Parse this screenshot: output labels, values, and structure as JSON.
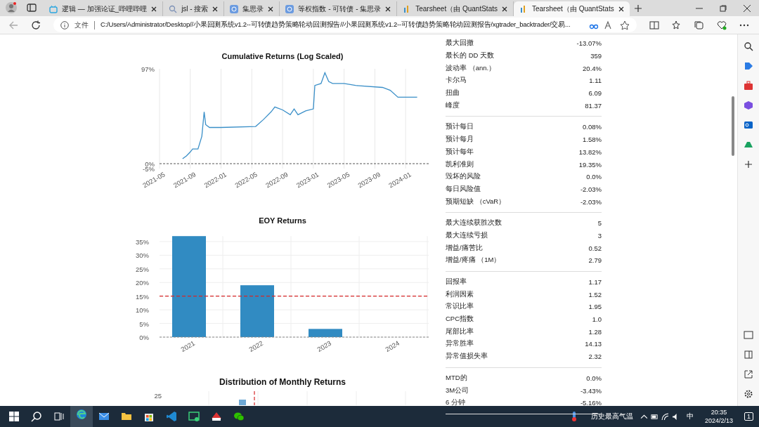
{
  "tabs": [
    {
      "label": "逻辑 — 加强论证_哔哩哔哩",
      "selected": false
    },
    {
      "label": "jsl - 搜索",
      "selected": false
    },
    {
      "label": "集思录",
      "selected": false
    },
    {
      "label": "等权指数 - 可转债 - 集思录",
      "selected": false
    },
    {
      "label": "Tearsheet（由 QuantStats",
      "selected": false
    },
    {
      "label": "Tearsheet（由 QuantStats",
      "selected": true
    }
  ],
  "address_bar": {
    "scheme_label": "文件",
    "url": "C:/Users/Administrator/Desktop//小果回测系统v1.2--可转债趋势策略轮动回测报告//小果回测系统v1.2--可转债趋势策略轮动回测报告/xgtrader_backtrader/交易..."
  },
  "cumulative_returns": {
    "chart_data": {
      "type": "line",
      "title": "Cumulative Returns (Log Scaled)",
      "x": [
        "2021-08-01",
        "2021-08-16",
        "2021-09-01",
        "2021-09-10",
        "2021-09-20",
        "2021-10-01",
        "2021-10-16",
        "2021-10-25",
        "2021-11-01",
        "2021-11-16",
        "2022-01-01",
        "2022-05-16",
        "2022-06-16",
        "2022-07-16",
        "2022-08-01",
        "2022-09-01",
        "2022-10-01",
        "2022-10-16",
        "2022-11-01",
        "2022-12-01",
        "2023-01-01",
        "2023-01-07",
        "2023-02-01",
        "2023-02-16",
        "2023-03-01",
        "2023-03-16",
        "2023-05-01",
        "2023-06-16",
        "2023-10-01",
        "2023-11-01",
        "2023-12-01",
        "2024-02-16"
      ],
      "series": [
        {
          "color": "#3a8fc8",
          "values": [
            5,
            8,
            12,
            15,
            15,
            15,
            28,
            53,
            40,
            37,
            37,
            38,
            45,
            53,
            58,
            55,
            50,
            56,
            50,
            54,
            56,
            80,
            82,
            93,
            84,
            82,
            82,
            80,
            78,
            75,
            68,
            68
          ]
        }
      ],
      "xlim": [
        "2021-05-01",
        "2024-04-01"
      ],
      "ylim": [
        -5,
        97
      ],
      "grid": true,
      "ref_lines": [
        {
          "axis": "y",
          "value": 0,
          "color": "#555555"
        }
      ],
      "xticks": [
        "2021-05",
        "2021-09",
        "2022-01",
        "2022-05",
        "2022-09",
        "2023-01",
        "2023-05",
        "2023-09",
        "2024-01"
      ],
      "yticks": [
        {
          "value": 97,
          "label": "97%"
        },
        {
          "value": 0,
          "label": "0%"
        },
        {
          "value": -5,
          "label": "-5%"
        }
      ]
    }
  },
  "eoy_returns": {
    "chart_data": {
      "type": "bar",
      "title": "EOY Returns",
      "categories": [
        "2021",
        "2022",
        "2023",
        "2024"
      ],
      "series": [
        {
          "color": "#318bc2",
          "values": [
            37,
            19,
            3,
            0
          ]
        }
      ],
      "ylim": [
        0,
        37
      ],
      "grid": true,
      "yticks": [
        {
          "value": 35,
          "label": "35%"
        },
        {
          "value": 30,
          "label": "30%"
        },
        {
          "value": 25,
          "label": "25%"
        },
        {
          "value": 20,
          "label": "20%"
        },
        {
          "value": 15,
          "label": "15%"
        },
        {
          "value": 10,
          "label": "10%"
        },
        {
          "value": 5,
          "label": "5%"
        },
        {
          "value": 0,
          "label": "0%"
        }
      ],
      "ref_lines": [
        {
          "axis": "y",
          "value": 15,
          "color": "#d62728"
        }
      ]
    }
  },
  "distribution_chart": {
    "title": "Distribution of Monthly Returns",
    "y_tick": "25"
  },
  "metrics": [
    [
      {
        "label": "最大回撤",
        "value": "-13.07%"
      },
      {
        "label": "最长的 DD 天数",
        "value": "359"
      },
      {
        "label": "波动率 （ann.）",
        "value": "20.4%"
      },
      {
        "label": "卡尔马",
        "value": "1.11"
      },
      {
        "label": "扭曲",
        "value": "6.09"
      },
      {
        "label": "峰度",
        "value": "81.37"
      }
    ],
    [
      {
        "label": "预计每日",
        "value": "0.08%"
      },
      {
        "label": "预计每月",
        "value": "1.58%"
      },
      {
        "label": "预计每年",
        "value": "13.82%"
      },
      {
        "label": "凯利准则",
        "value": "19.35%"
      },
      {
        "label": "毁坏的风险",
        "value": "0.0%"
      },
      {
        "label": "每日风险值",
        "value": "-2.03%"
      },
      {
        "label": "预期短缺 （cVaR）",
        "value": "-2.03%"
      }
    ],
    [
      {
        "label": "最大连续获胜次数",
        "value": "5"
      },
      {
        "label": "最大连续亏损",
        "value": "3"
      },
      {
        "label": "增益/痛苦比",
        "value": "0.52"
      },
      {
        "label": "增益/疼痛 （1M）",
        "value": "2.79"
      }
    ],
    [
      {
        "label": "回报率",
        "value": "1.17"
      },
      {
        "label": "利润因素",
        "value": "1.52"
      },
      {
        "label": "常识比率",
        "value": "1.95"
      },
      {
        "label": "CPC指数",
        "value": "1.0"
      },
      {
        "label": "尾部比率",
        "value": "1.28"
      },
      {
        "label": "异常胜率",
        "value": "14.13"
      },
      {
        "label": "异常值损失率",
        "value": "2.32"
      }
    ],
    [
      {
        "label": "MTD的",
        "value": "0.0%"
      },
      {
        "label": "3M公司",
        "value": "-3.43%"
      },
      {
        "label": "6 分钟",
        "value": "-5.16%"
      }
    ]
  ],
  "taskbar": {
    "weather": "历史最高气温",
    "ime": "中",
    "time": "20:35",
    "date": "2024/2/13",
    "notifications": "1"
  }
}
